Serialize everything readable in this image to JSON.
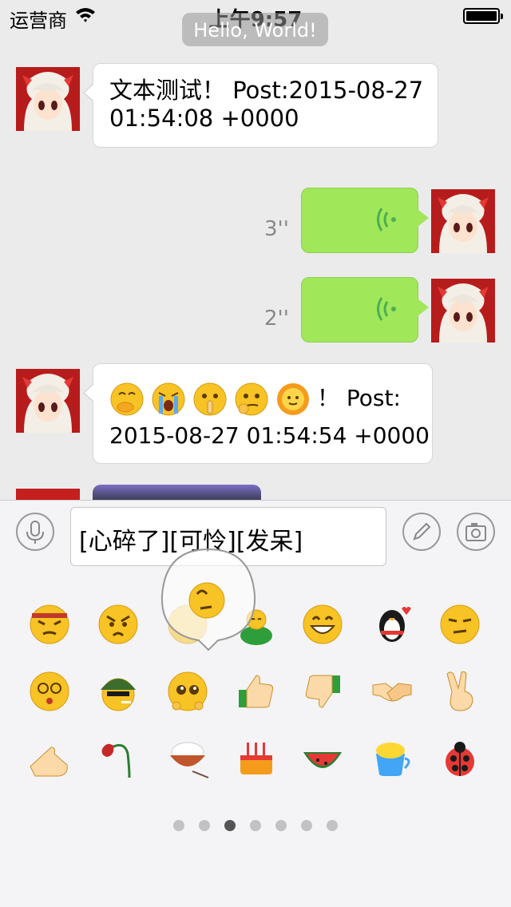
{
  "status_bar": {
    "carrier": "运营商",
    "time": "上午9:57"
  },
  "toast": "Hello, World!",
  "messages": [
    {
      "side": "left",
      "text_line1": "文本测试！ Post:2015-08-27",
      "text_line2": "01:54:08 +0000"
    },
    {
      "side": "right",
      "type": "voice",
      "duration": "3''"
    },
    {
      "side": "right",
      "type": "voice",
      "duration": "2''"
    },
    {
      "side": "left",
      "type": "emoji_text",
      "emojis": [
        "捂嘴笑",
        "大哭",
        "嘘",
        "思考",
        "太阳"
      ],
      "text_line1": "！ Post:",
      "text_line2": "2015-08-27 01:54:54 +0000"
    },
    {
      "side": "left",
      "type": "image"
    }
  ],
  "input": {
    "text": "[心碎了][可怜][发呆]"
  },
  "colors": {
    "voice_bubble": "#a0e75a",
    "background": "#ebebeb",
    "accent_wave": "#4caf50"
  },
  "emoji_grid": [
    [
      "headband-face",
      "angry-face",
      "drooling-face",
      "sleeping-blob",
      "grinning-face",
      "penguin",
      "smirk-face"
    ],
    [
      "dizzy-face",
      "soldier-face",
      "pitiful-face",
      "thumbs-up",
      "thumbs-down",
      "handshake",
      "victory-hand"
    ],
    [
      "fist-palm",
      "wilted-rose",
      "rice-bowl",
      "cake",
      "watermelon",
      "coffee-cup",
      "ladybug"
    ]
  ],
  "magnified_emoji": "dazed-face",
  "pages": {
    "count": 7,
    "current": 3
  }
}
